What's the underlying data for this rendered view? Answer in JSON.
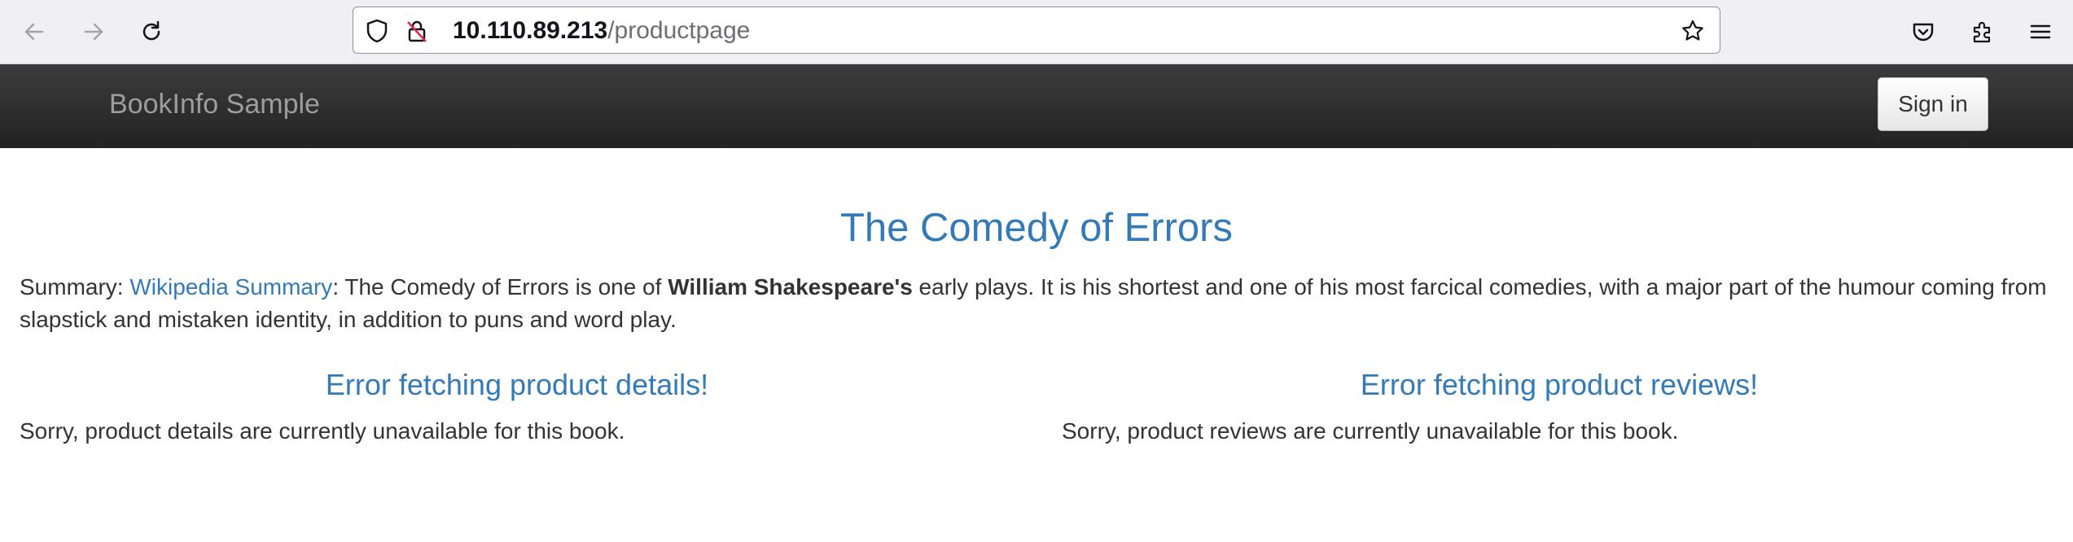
{
  "browser": {
    "url_host": "10.110.89.213",
    "url_path": "/productpage"
  },
  "navbar": {
    "brand": "BookInfo Sample",
    "signin_label": "Sign in"
  },
  "product": {
    "title": "The Comedy of Errors",
    "summary_prefix": "Summary: ",
    "summary_link": "Wikipedia Summary",
    "summary_mid": ": The Comedy of Errors is one of ",
    "summary_bold": "William Shakespeare's",
    "summary_rest": " early plays. It is his shortest and one of his most farcical comedies, with a major part of the humour coming from slapstick and mistaken identity, in addition to puns and word play."
  },
  "details": {
    "heading": "Error fetching product details!",
    "message": "Sorry, product details are currently unavailable for this book."
  },
  "reviews": {
    "heading": "Error fetching product reviews!",
    "message": "Sorry, product reviews are currently unavailable for this book."
  },
  "colors": {
    "accent": "#337ab7",
    "navbar": "#222222",
    "text": "#333333"
  }
}
